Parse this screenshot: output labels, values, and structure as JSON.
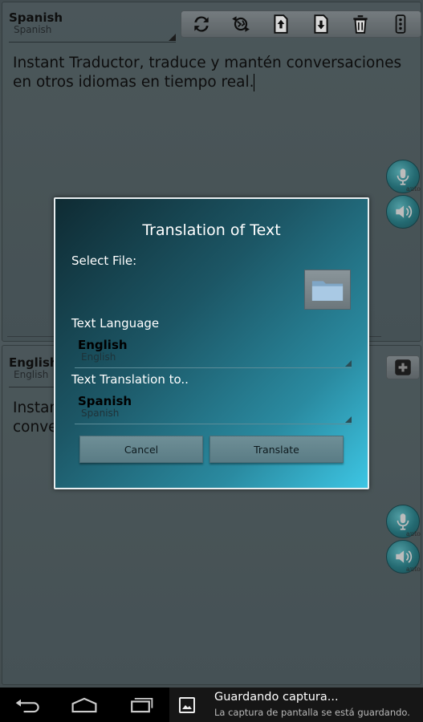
{
  "top_panel": {
    "language": "Spanish",
    "language_sub": "Spanish",
    "text": "Instant Traductor, traduce y mantén conversaciones en otros idiomas en tiempo real.",
    "mic_auto": "auto"
  },
  "bottom_panel": {
    "language": "English",
    "language_sub": "English",
    "text_line1": "Instan",
    "text_line2": "conve",
    "mic_auto": "auto"
  },
  "dialog": {
    "title": "Translation of Text",
    "select_file_label": "Select File:",
    "text_language_label": "Text Language",
    "source_language": "English",
    "source_language_sub": "English",
    "translate_to_label": "Text Translation to..",
    "target_language": "Spanish",
    "target_language_sub": "Spanish",
    "cancel_label": "Cancel",
    "translate_label": "Translate"
  },
  "notification": {
    "title": "Guardando captura...",
    "text": "La captura de pantalla se está guardando."
  },
  "colors": {
    "accent": "#2b7d86",
    "dialog_bg_start": "#0f2b33",
    "dialog_bg_end": "#3dc6e4"
  }
}
